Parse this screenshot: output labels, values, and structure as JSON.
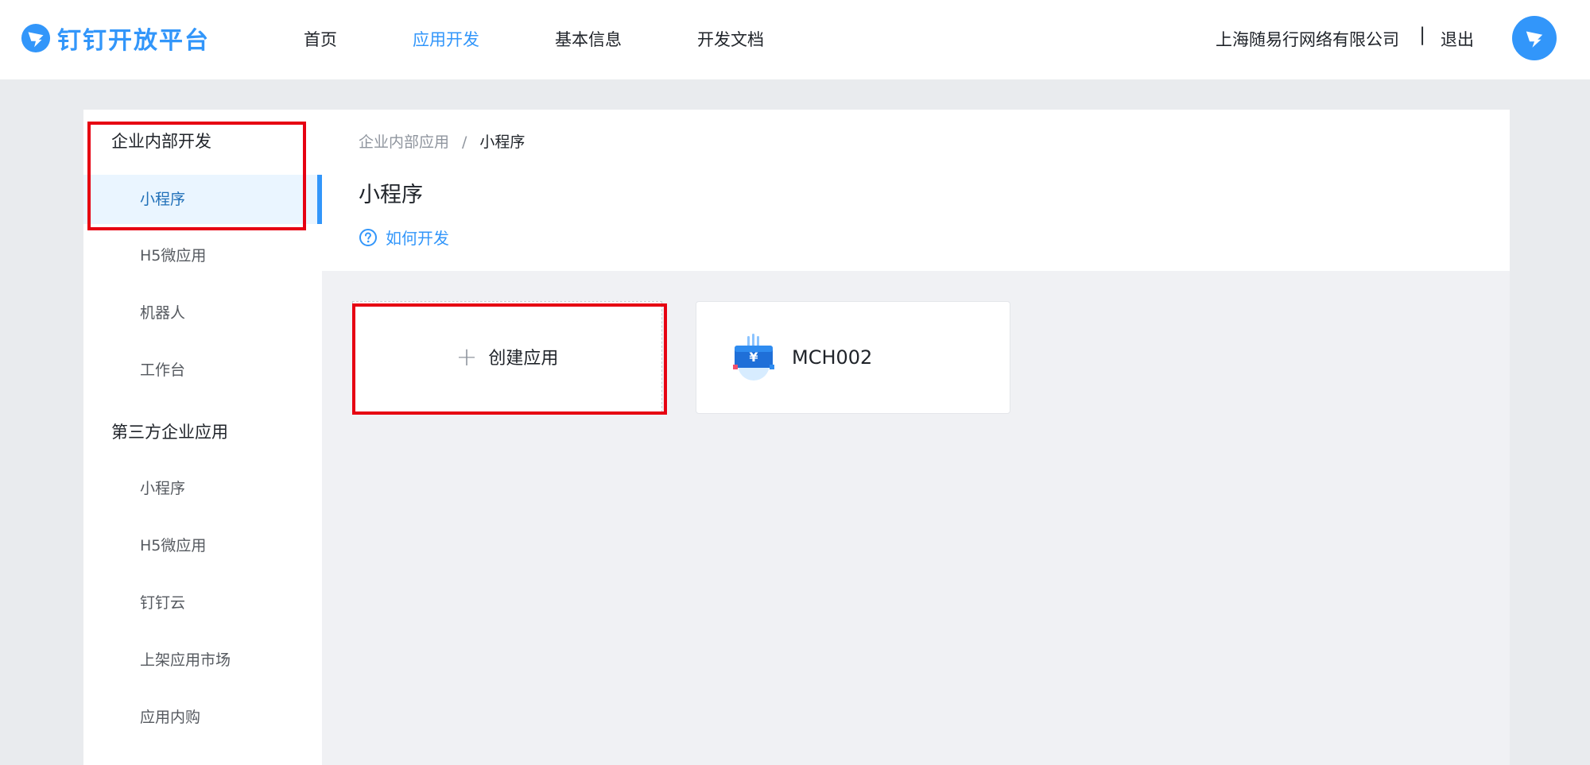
{
  "brand": {
    "name": "钉钉开放平台",
    "color": "#3296fa",
    "logo_icon": "dingtalk-logo-icon"
  },
  "nav": {
    "items": [
      {
        "label": "首页",
        "active": false
      },
      {
        "label": "应用开发",
        "active": true
      },
      {
        "label": "基本信息",
        "active": false
      },
      {
        "label": "开发文档",
        "active": false
      }
    ]
  },
  "user": {
    "company": "上海随易行网络有限公司",
    "separator": "|",
    "logout": "退出",
    "avatar_icon": "dingtalk-avatar-icon"
  },
  "sidebar": {
    "groups": [
      {
        "title": "企业内部开发",
        "items": [
          {
            "label": "小程序",
            "active": true
          },
          {
            "label": "H5微应用",
            "active": false
          },
          {
            "label": "机器人",
            "active": false
          },
          {
            "label": "工作台",
            "active": false
          }
        ]
      },
      {
        "title": "第三方企业应用",
        "items": [
          {
            "label": "小程序",
            "active": false
          },
          {
            "label": "H5微应用",
            "active": false
          },
          {
            "label": "钉钉云",
            "active": false
          },
          {
            "label": "上架应用市场",
            "active": false
          },
          {
            "label": "应用内购",
            "active": false
          }
        ]
      }
    ]
  },
  "breadcrumb": {
    "parent": "企业内部应用",
    "separator": "/",
    "current": "小程序"
  },
  "page": {
    "title": "小程序",
    "help_link": "如何开发",
    "help_icon": "question-circle-icon"
  },
  "cards": {
    "create": {
      "plus": "+",
      "label": "创建应用"
    },
    "apps": [
      {
        "name": "MCH002",
        "icon": "wallet-app-icon"
      }
    ]
  },
  "highlight_color": "#e60012"
}
